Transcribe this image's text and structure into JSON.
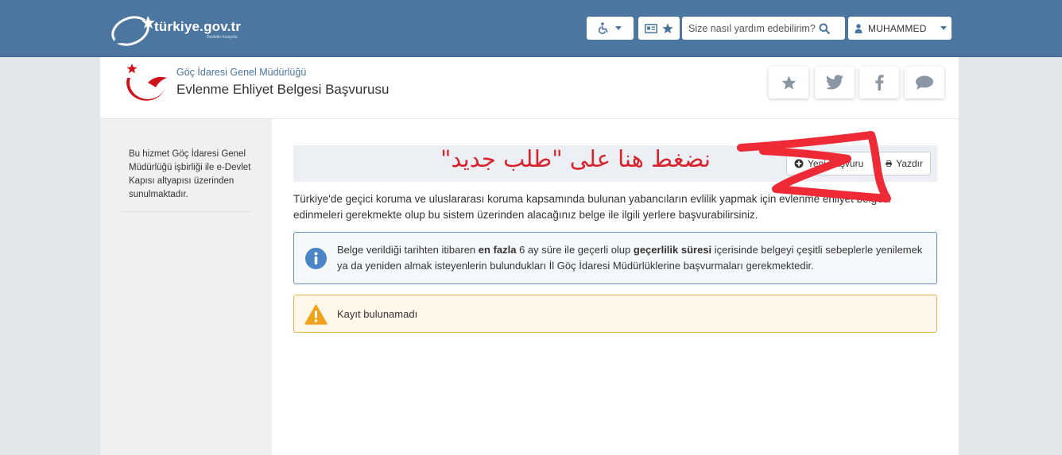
{
  "header": {
    "logo_text": "türkiye.gov.tr",
    "logo_subtext": "Devletin Kısayolu",
    "search_placeholder": "Size nasıl yardım edebilirim?",
    "user_name": "MUHAMMED",
    "accent_color": "#4a76a0"
  },
  "service": {
    "agency": "Göç İdaresi Genel Müdürlüğü",
    "title": "Evlenme Ehliyet Belgesi Başvurusu",
    "share_icons": [
      "star-icon",
      "twitter-icon",
      "facebook-icon",
      "comment-icon"
    ]
  },
  "sidebar": {
    "note": "Bu hizmet Göç İdaresi Genel Müdürlüğü işbirliği ile e-Devlet Kapısı altyapısı üzerinden sunulmaktadır."
  },
  "actions": {
    "new_application": "Yeni Başvuru",
    "print": "Yazdır"
  },
  "main": {
    "intro": "Türkiye'de geçici koruma ve uluslararası koruma kapsamında bulunan yabancıların evlilik yapmak için evlenme ehliyet belgesi edinmeleri gerekmekte olup bu sistem üzerinden alacağınız belge ile ilgili yerlere başvurabilirsiniz.",
    "info": {
      "part1": "Belge verildiği tarihten itibaren ",
      "bold1": "en fazla",
      "part2": " 6 ay süre ile geçerli olup ",
      "bold2": "geçerlilik süresi",
      "part3": " içerisinde belgeyi çeşitli sebeplerle yenilemek ya da yeniden almak isteyenlerin bulundukları İl Göç İdaresi Müdürlüklerine başvurmaları gerekmektedir."
    },
    "warning": "Kayıt bulunamadı"
  },
  "annotation": {
    "text": "نضغط هنا على \"طلب جديد\"",
    "color": "#d8222c"
  }
}
